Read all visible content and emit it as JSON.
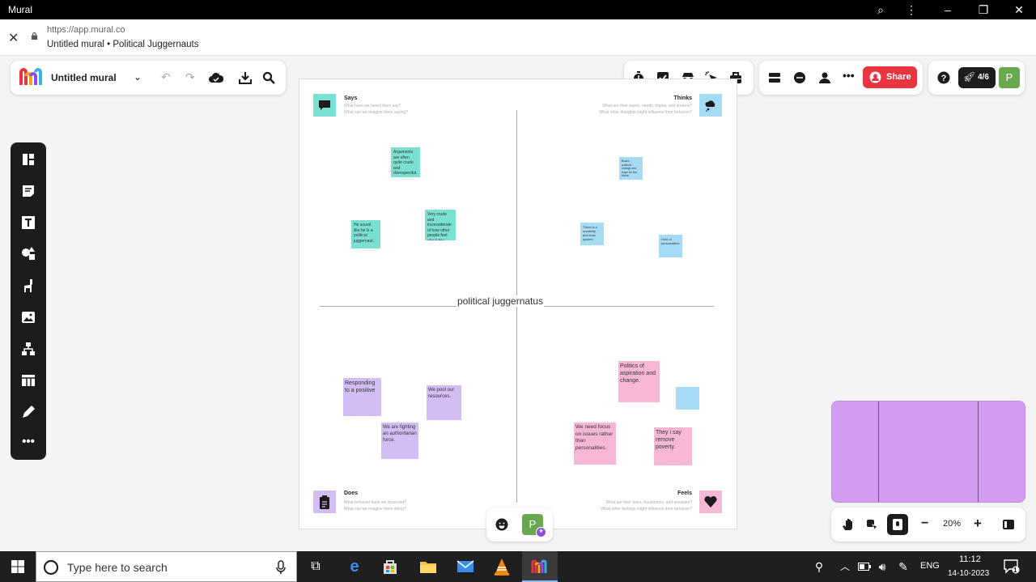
{
  "window": {
    "title": "Mural"
  },
  "browser": {
    "url": "https://app.mural.co",
    "page_title": "Untitled mural • Political Juggernauts"
  },
  "toolbar": {
    "mural_name": "Untitled mural",
    "share_label": "Share",
    "participants": "4/6",
    "avatar_letter": "P"
  },
  "board": {
    "center_label": "political juggernatus",
    "quadrants": {
      "says": {
        "title": "Says",
        "sub1": "What have we heard them say?",
        "sub2": "What can we imagine them saying?"
      },
      "thinks": {
        "title": "Thinks",
        "sub1": "What are their wants, needs, hopes, and dreams?",
        "sub2": "What other thoughts might influence their behavior?"
      },
      "does": {
        "title": "Does",
        "sub1": "What behavior have we observed?",
        "sub2": "What can we imagine them doing?"
      },
      "feels": {
        "title": "Feels",
        "sub1": "What are their fears, frustrations, and anxieties?",
        "sub2": "What other feelings might influence their behavior?"
      }
    },
    "notes": {
      "n1": "Arguments are often quite crude and disrespectful.",
      "n2": "He sound like he is a political juggernaut.",
      "n3": "Very crude and inconsiderate of how other people feel about the issue.",
      "n4": "Board - political change and hope for the future",
      "n5": "There is a creativity and trust system",
      "n6": "Hold of personalities",
      "n7": "Responding to a positive",
      "n8": "We pool our resources.",
      "n9": "We are fighting an authoritarian force.",
      "n10": "Politics of aspiration and change.",
      "n11": "We need focus on issues rather than personalities.",
      "n12": "They i say remove poverty."
    }
  },
  "zoom": {
    "level": "20%"
  },
  "taskbar": {
    "search_placeholder": "Type here to search",
    "language": "ENG",
    "time": "11:12",
    "date": "14-10-2023",
    "notifications": "1"
  },
  "colors": {
    "teal": "#79e0d2",
    "blue": "#a6dbf6",
    "purple": "#d3bdf5",
    "pink": "#f7b8d8",
    "share_red": "#e8353f",
    "minimap": "#d49cf0",
    "avatar_green": "#6aa84f"
  }
}
